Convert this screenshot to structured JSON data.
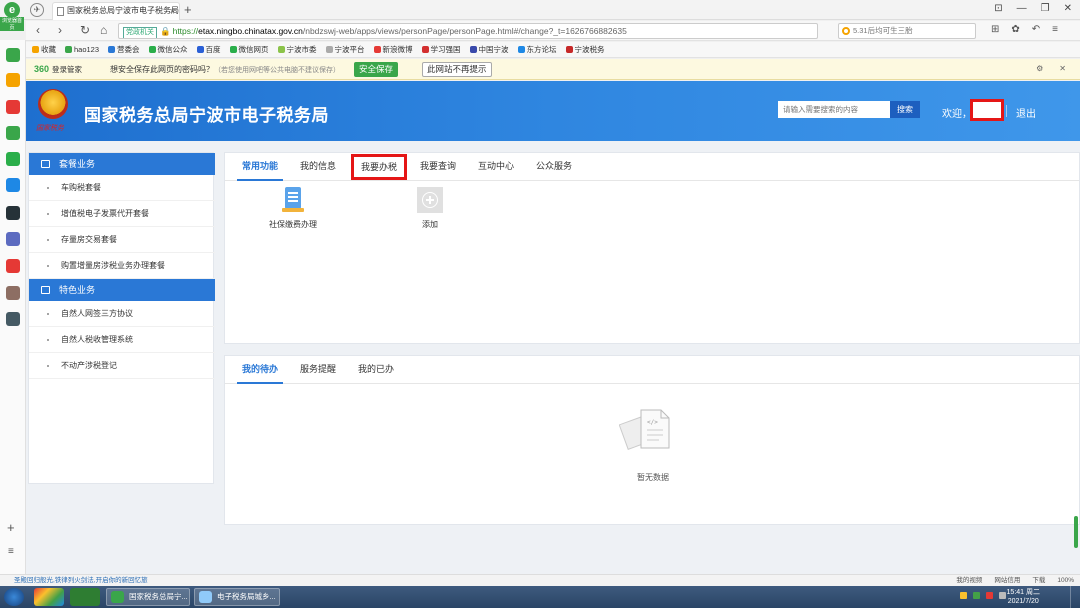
{
  "browser": {
    "logo_text": "e",
    "logo_label": "浏览器首页",
    "tab_title": "国家税务总局宁波市电子税务局",
    "tab_close": "×",
    "new_tab": "+",
    "window_controls": [
      "⊡",
      "—",
      "❐",
      "✕"
    ],
    "nav": {
      "back": "‹",
      "forward": "›",
      "reload": "↻",
      "home": "⌂"
    },
    "cert_label": "党政机关",
    "url_https": "https://",
    "url_host": "etax.ningbo.chinatax.gov.cn",
    "url_path": "/nbdzswj-web/apps/views/personPage/personPage.html#/change?_t=1626766882635",
    "search_text": "5.31后均可生三胎",
    "toolbar_icons": [
      "⊞",
      "✿",
      "↶",
      "≡"
    ]
  },
  "bookmarks": [
    "收藏",
    "hao123",
    "营委会",
    "微信公众",
    "百度",
    "微信网页",
    "宁波市委",
    "宁波平台",
    "新浪微博",
    "学习强国",
    "中国宁波",
    "东方论坛",
    "宁波税务"
  ],
  "password_bar": {
    "logo": "360",
    "logo_sub": "登录管家",
    "question": "想安全保存此网页的密码吗？",
    "tip": "（若您使用网吧等公共电脑不建议保存）",
    "save_button": "安全保存",
    "never_button": "此网站不再提示",
    "controls": [
      "⚙",
      "✕"
    ]
  },
  "header": {
    "emblem_sub": "国家税务",
    "title": "国家税务总局宁波市电子税务局",
    "search_placeholder": "请输入需要搜索的内容",
    "search_button": "搜索",
    "welcome": "欢迎，",
    "logout": "退出"
  },
  "left_menu": {
    "groups": [
      {
        "title": "套餐业务",
        "items": [
          "车购税套餐",
          "增值税电子发票代开套餐",
          "存量房交易套餐",
          "购置增量房涉税业务办理套餐"
        ]
      },
      {
        "title": "特色业务",
        "items": [
          "自然人网签三方协议",
          "自然人税收管理系统",
          "不动产涉税登记"
        ]
      }
    ]
  },
  "top_panel": {
    "tabs": [
      "常用功能",
      "我的信息",
      "我要办税",
      "我要查询",
      "互动中心",
      "公众服务"
    ],
    "active_tab": "常用功能",
    "highlighted_tab": "我要办税",
    "functions": [
      {
        "label": "社保缴费办理"
      },
      {
        "label": "添加"
      }
    ]
  },
  "bottom_panel": {
    "tabs": [
      "我的待办",
      "服务提醒",
      "我的已办"
    ],
    "active_tab": "我的待办",
    "empty_text": "暂无数据"
  },
  "statusbar": {
    "left": "圣殿回归般光,铁律列火剑法,开启你的新回忆旅",
    "right": [
      "我的视频",
      "网站信用",
      "下载",
      "100%"
    ]
  },
  "taskbar": {
    "buttons": [
      "国家税务总局宁...",
      "电子税务局城乡..."
    ],
    "time": "15:41 周二",
    "date": "2021/7/20"
  },
  "colors": {
    "brand_blue": "#2a78d6",
    "header_blue": "#1e6fcf",
    "highlight_red": "#e51616",
    "green": "#3aa64a"
  }
}
